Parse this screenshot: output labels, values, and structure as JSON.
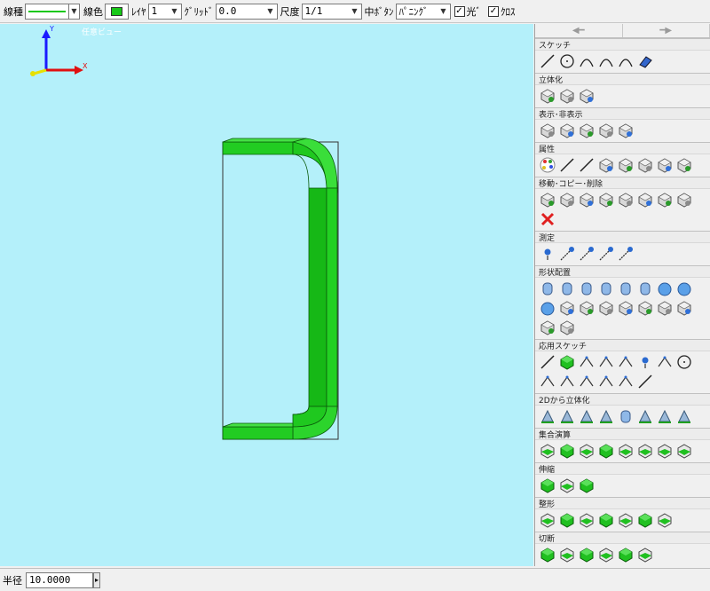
{
  "toolbar": {
    "line_type_label": "線種",
    "line_color_label": "線色",
    "layer_label": "ﾚｲﾔ",
    "layer_value": "1",
    "grid_label": "ｸﾞﾘｯﾄﾞ",
    "grid_value": "0.0",
    "scale_label": "尺度",
    "scale_value": "1/1",
    "middle_button_label": "中ﾎﾞﾀﾝ",
    "middle_button_value": "ﾊﾟﾆﾝｸﾞ",
    "light_label": "光ﾞ",
    "cross_label": "ｸﾛｽ",
    "line_color": "#18c818",
    "light_checked": true,
    "cross_checked": true
  },
  "viewport": {
    "view_name": "任意ビュー",
    "background": "#b4f0fa",
    "axis_y_label": "Y",
    "axis_x_label": "X",
    "model_color": "#1ed21e"
  },
  "panel": {
    "nav_prev_icon": "arrow-left-icon",
    "nav_next_icon": "arrow-right-icon",
    "sections": [
      {
        "key": "sketch",
        "title": "スケッチ",
        "tools": [
          "line-icon",
          "circle-icon",
          "arc-icon",
          "three-point-arc-icon",
          "spline-icon",
          "eraser-icon"
        ]
      },
      {
        "key": "solidify",
        "title": "立体化",
        "tools": [
          "extrude-icon",
          "extrude-both-icon",
          "revolve-icon"
        ]
      },
      {
        "key": "show-hide",
        "title": "表示･非表示",
        "tools": [
          "hide-icon",
          "show-layer-icon",
          "hide-selected-icon",
          "show-all-icon",
          "show-hidden-icon"
        ]
      },
      {
        "key": "attribute",
        "title": "属性",
        "tools": [
          "color-palette-icon",
          "line-style-icon",
          "line-width-icon",
          "wireframe-icon",
          "solid-icon",
          "layer-stack-icon",
          "material-icon",
          "shading-icon"
        ]
      },
      {
        "key": "move-copy-delete",
        "title": "移動･コピー･削除",
        "tools": [
          "move-icon",
          "rotate-icon",
          "mirror-icon",
          "copy-move-icon",
          "copy-linear-icon",
          "copy-rotate-icon",
          "copy-mirror-icon",
          "copy-scale-icon",
          "delete-icon"
        ]
      },
      {
        "key": "measure",
        "title": "測定",
        "tools": [
          "measure-point-icon",
          "measure-distance-icon",
          "measure-length-icon",
          "measure-angle-icon",
          "measure-volume-icon"
        ]
      },
      {
        "key": "shape-place",
        "title": "形状配置",
        "tools": [
          "cylinder-icon",
          "box-icon",
          "capsule-icon",
          "cone-icon",
          "bullet-icon",
          "torus-icon",
          "sphere-icon",
          "hemisphere-icon",
          "dome-icon",
          "gear-icon",
          "spring-icon",
          "nut-icon",
          "bolt-icon",
          "pipe-icon",
          "pipe-bend-icon",
          "pipe-elbow-icon",
          "pipe-tee-icon",
          "pipe-cross-icon"
        ]
      },
      {
        "key": "applied-sketch",
        "title": "応用スケッチ",
        "tools": [
          "offset-line-icon",
          "fillet-icon",
          "chamfer-icon",
          "slot-icon",
          "hatch-icon",
          "point-icon",
          "dash-line-icon",
          "polygon-icon",
          "trim-icon",
          "extend-icon",
          "break-icon",
          "corner-icon",
          "divide-icon",
          "tangent-line-icon"
        ]
      },
      {
        "key": "from-2d",
        "title": "2Dから立体化",
        "tools": [
          "from2d-extrude-icon",
          "from2d-revolve-icon",
          "from2d-sweep-icon",
          "from2d-loft-icon",
          "from2d-cone-icon",
          "from2d-pyramid-icon",
          "from2d-spiral-icon",
          "from2d-stack-icon"
        ]
      },
      {
        "key": "boolean",
        "title": "集合演算",
        "tools": [
          "union-icon",
          "subtract-icon",
          "intersect-icon",
          "split-icon",
          "merge-icon",
          "section-icon",
          "slice-icon",
          "separate-icon"
        ]
      },
      {
        "key": "stretch",
        "title": "伸縮",
        "tools": [
          "stretch-face-icon",
          "stretch-direction-icon",
          "offset-face-icon"
        ]
      },
      {
        "key": "shaping",
        "title": "整形",
        "tools": [
          "round-edge-icon",
          "chamfer-edge-icon",
          "shell-icon",
          "draft-icon",
          "fill-hole-icon",
          "thicken-icon",
          "cut-face-icon"
        ]
      },
      {
        "key": "cut",
        "title": "切断",
        "tools": [
          "cut-plane-icon",
          "cut-curve-icon",
          "cut-box-icon",
          "cut-section-icon",
          "cut-split-icon",
          "cut-layer-icon"
        ]
      }
    ]
  },
  "statusbar": {
    "radius_label": "半径",
    "radius_value": "10.0000"
  }
}
